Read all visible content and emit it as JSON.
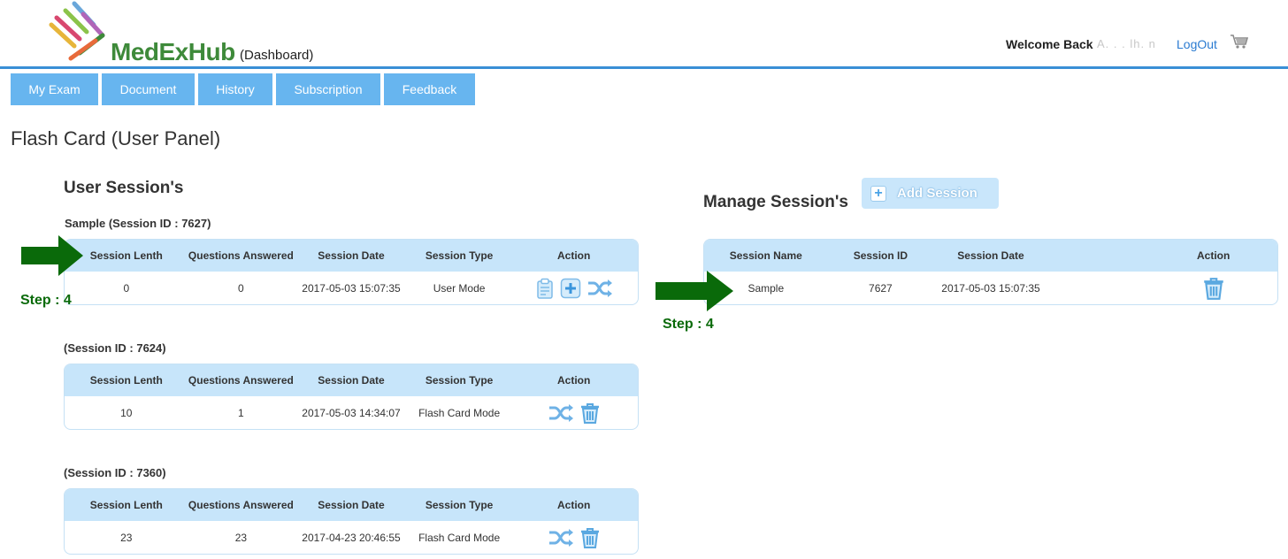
{
  "header": {
    "brand": "MedExHub",
    "brand_sub": "(Dashboard)",
    "welcome": "Welcome Back",
    "user_name": "A. . . lh. n",
    "logout": "LogOut"
  },
  "nav": [
    {
      "label": "My Exam"
    },
    {
      "label": "Document"
    },
    {
      "label": "History"
    },
    {
      "label": "Subscription"
    },
    {
      "label": "Feedback"
    }
  ],
  "page_title": "Flash Card (User Panel)",
  "user_sessions": {
    "title": "User Session's",
    "columns": [
      "Session Lenth",
      "Questions Answered",
      "Session Date",
      "Session Type",
      "Action"
    ],
    "sessions": [
      {
        "label": "Sample (Session ID : 7627)",
        "length": "0",
        "answered": "0",
        "date": "2017-05-03 15:07:35",
        "type": "User Mode"
      },
      {
        "label": "(Session ID : 7624)",
        "length": "10",
        "answered": "1",
        "date": "2017-05-03 14:34:07",
        "type": "Flash Card Mode"
      },
      {
        "label": "(Session ID : 7360)",
        "length": "23",
        "answered": "23",
        "date": "2017-04-23 20:46:55",
        "type": "Flash Card Mode"
      }
    ]
  },
  "manage_sessions": {
    "title": "Manage Session's",
    "add_button": "Add Session",
    "columns": [
      "Session Name",
      "Session ID",
      "Session Date",
      "Action"
    ],
    "rows": [
      {
        "name": "Sample",
        "id": "7627",
        "date": "2017-05-03 15:07:35"
      }
    ]
  },
  "annotations": {
    "step_left": "Step : 4",
    "step_right": "Step : 4"
  },
  "colors": {
    "nav_bg": "#67b5ef",
    "header_border": "#3a8fd6",
    "table_head": "#c7e5fa",
    "brand_green": "#3e8a3a",
    "arrow_green": "#0a6a0a",
    "icon_blue": "#5aa8e0"
  }
}
